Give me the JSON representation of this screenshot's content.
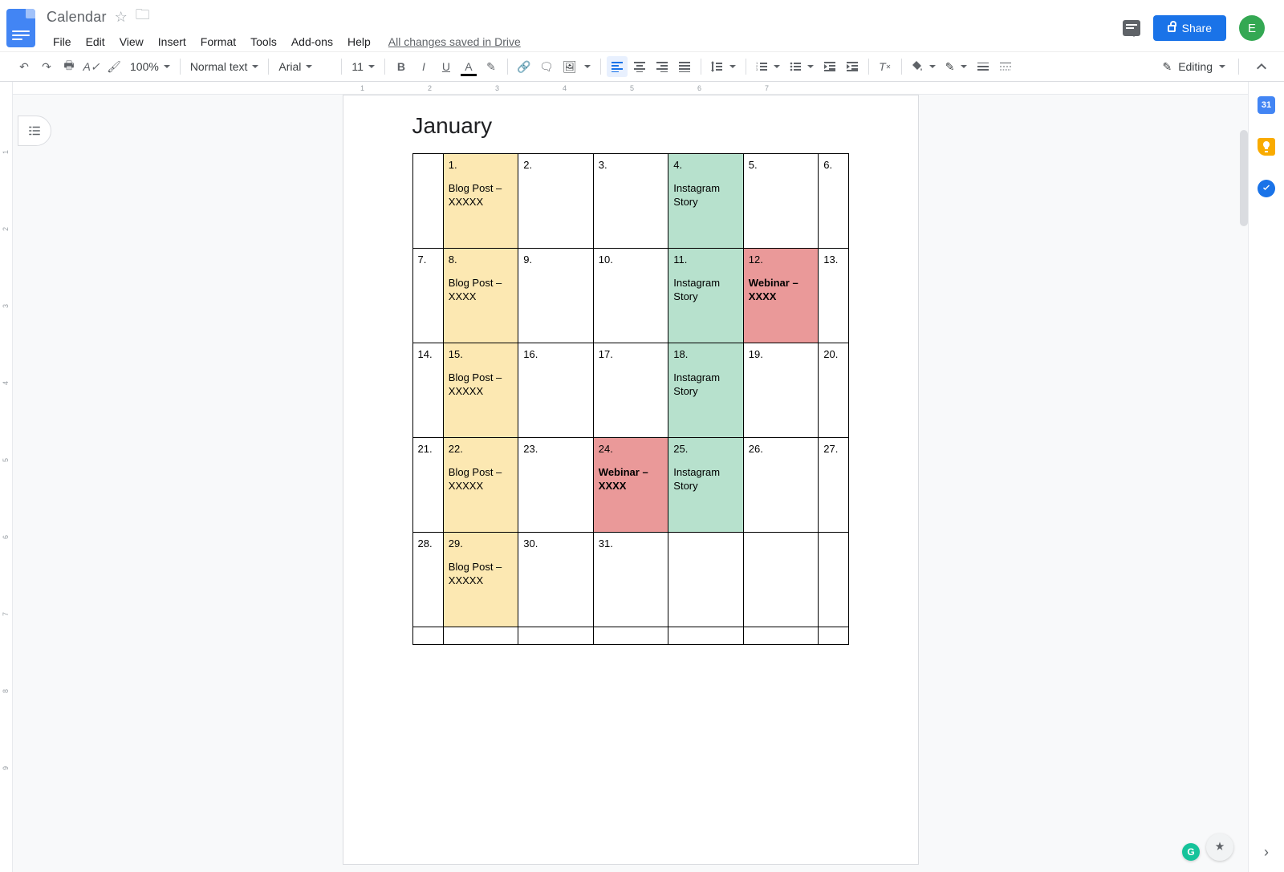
{
  "header": {
    "doc_title": "Calendar",
    "save_status": "All changes saved in Drive",
    "share_label": "Share",
    "avatar_letter": "E"
  },
  "menubar": {
    "items": [
      "File",
      "Edit",
      "View",
      "Insert",
      "Format",
      "Tools",
      "Add-ons",
      "Help"
    ]
  },
  "toolbar": {
    "zoom": "100%",
    "style": "Normal text",
    "font": "Arial",
    "font_size": "11",
    "mode": "Editing"
  },
  "ruler": {
    "h_ticks": [
      {
        "pos": 0,
        "label": ""
      },
      {
        "pos": 84,
        "label": ""
      },
      {
        "pos": 168,
        "label": "1"
      },
      {
        "pos": 252,
        "label": "2"
      },
      {
        "pos": 336,
        "label": "3"
      },
      {
        "pos": 420,
        "label": "4"
      },
      {
        "pos": 504,
        "label": "5"
      },
      {
        "pos": 588,
        "label": "6"
      },
      {
        "pos": 672,
        "label": "7"
      }
    ],
    "v_ticks": [
      "1",
      "2",
      "3",
      "4",
      "5",
      "6",
      "7",
      "8",
      "9"
    ]
  },
  "document": {
    "heading": "January",
    "rows": [
      [
        {
          "num": "",
          "event": "",
          "cls": ""
        },
        {
          "num": "1.",
          "event": "Blog Post  – XXXXX",
          "cls": "yellow"
        },
        {
          "num": "2.",
          "event": "",
          "cls": ""
        },
        {
          "num": "3.",
          "event": "",
          "cls": ""
        },
        {
          "num": "4.",
          "event": "Instagram Story",
          "cls": "green"
        },
        {
          "num": "5.",
          "event": "",
          "cls": ""
        },
        {
          "num": "6.",
          "event": "",
          "cls": ""
        }
      ],
      [
        {
          "num": "7.",
          "event": "",
          "cls": ""
        },
        {
          "num": "8.",
          "event": "Blog Post – XXXX",
          "cls": "yellow"
        },
        {
          "num": "9.",
          "event": "",
          "cls": ""
        },
        {
          "num": "10.",
          "event": "",
          "cls": ""
        },
        {
          "num": "11.",
          "event": "Instagram Story",
          "cls": "green"
        },
        {
          "num": "12.",
          "event": "Webinar – XXXX",
          "cls": "red"
        },
        {
          "num": "13.",
          "event": "",
          "cls": ""
        }
      ],
      [
        {
          "num": "14.",
          "event": "",
          "cls": ""
        },
        {
          "num": "15.",
          "event": "Blog Post  – XXXXX",
          "cls": "yellow"
        },
        {
          "num": "16.",
          "event": "",
          "cls": ""
        },
        {
          "num": "17.",
          "event": "",
          "cls": ""
        },
        {
          "num": "18.",
          "event": "Instagram Story",
          "cls": "green"
        },
        {
          "num": "19.",
          "event": "",
          "cls": ""
        },
        {
          "num": "20.",
          "event": "",
          "cls": ""
        }
      ],
      [
        {
          "num": "21.",
          "event": "",
          "cls": ""
        },
        {
          "num": "22.",
          "event": "Blog Post  – XXXXX",
          "cls": "yellow"
        },
        {
          "num": "23.",
          "event": "",
          "cls": ""
        },
        {
          "num": "24.",
          "event": "Webinar – XXXX",
          "cls": "red"
        },
        {
          "num": "25.",
          "event": "Instagram Story",
          "cls": "green"
        },
        {
          "num": "26.",
          "event": "",
          "cls": ""
        },
        {
          "num": "27.",
          "event": "",
          "cls": ""
        }
      ],
      [
        {
          "num": "28.",
          "event": "",
          "cls": ""
        },
        {
          "num": "29.",
          "event": "Blog Post  – XXXXX",
          "cls": "yellow"
        },
        {
          "num": "30.",
          "event": "",
          "cls": ""
        },
        {
          "num": "31.",
          "event": "",
          "cls": ""
        },
        {
          "num": "",
          "event": "",
          "cls": ""
        },
        {
          "num": "",
          "event": "",
          "cls": ""
        },
        {
          "num": "",
          "event": "",
          "cls": ""
        }
      ],
      [
        {
          "num": "",
          "event": "",
          "cls": ""
        },
        {
          "num": "",
          "event": "",
          "cls": ""
        },
        {
          "num": "",
          "event": "",
          "cls": ""
        },
        {
          "num": "",
          "event": "",
          "cls": ""
        },
        {
          "num": "",
          "event": "",
          "cls": ""
        },
        {
          "num": "",
          "event": "",
          "cls": ""
        },
        {
          "num": "",
          "event": "",
          "cls": ""
        }
      ]
    ]
  },
  "right_rail": {
    "calendar_day": "31"
  }
}
